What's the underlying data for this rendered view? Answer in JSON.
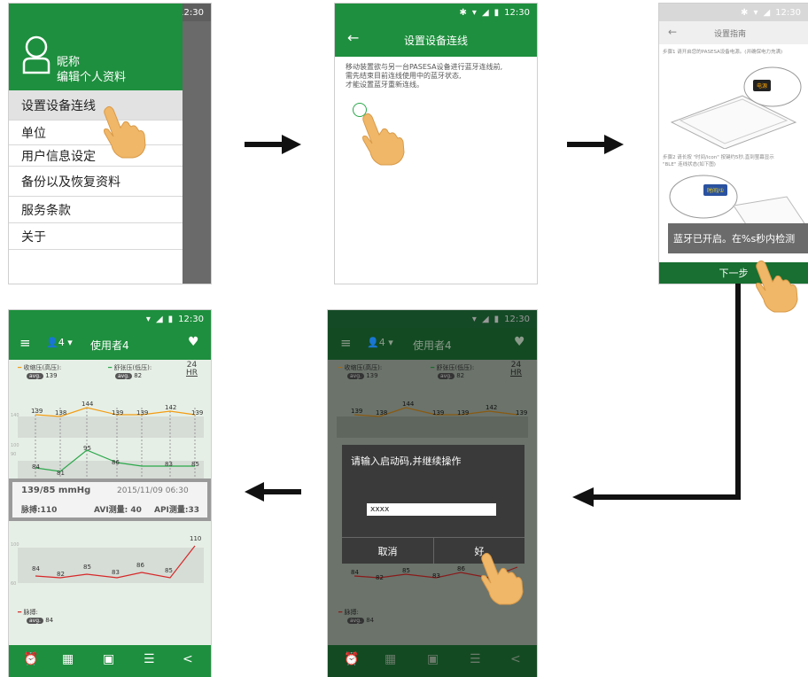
{
  "status_time": "12:30",
  "p1": {
    "nickname": "昵称",
    "edit_profile": "编辑个人资料",
    "menu": [
      "设置设备连线",
      "单位",
      "用户信息设定",
      "备份以及恢复资料",
      "服务条款",
      "关于"
    ]
  },
  "p2": {
    "title": "设置设备连线",
    "body_line1": "移动装置欲与另一台PASESA设备进行蓝牙连线前,",
    "body_line2": "需先结束目前连线使用中的蓝牙状态,",
    "body_line3": "才能设置蓝牙重新连线。"
  },
  "p3": {
    "title": "设置指南",
    "step1": "步骤1 请开启您的PASESA设备电源。(并确保电力充满)",
    "step2_line1": "步骤2 请长按 \"时间/icon\" 按键约5秒,直到萤幕显示",
    "step2_line2": "\"BLE\" 连线状态(如下图)",
    "toast": "蓝牙已开启。在%s秒内检测",
    "next": "下一步",
    "lcd1": "电源",
    "lcd2": "时间/①"
  },
  "p4": {
    "user": "使用者4",
    "user_count": "4",
    "systolic": "收缩压(高压):",
    "diastolic": "舒张压(低压):",
    "avg_sys": "139",
    "avg_dia": "82",
    "range_top": "24",
    "range_bottom": "HR",
    "avg_badge": "avg.",
    "sys_points": [
      "139",
      "138",
      "144",
      "139",
      "139",
      "142",
      "139"
    ],
    "dia_points": [
      "84",
      "81",
      "95",
      "86",
      "83",
      "85"
    ],
    "card_bp": "139/85 mmHg",
    "card_date": "2015/11/09 06:30",
    "card_pulse": "脉搏:110",
    "card_avi": "AVI测量: 40",
    "card_api": "API测量:33",
    "pulse_points": [
      "84",
      "82",
      "85",
      "83",
      "86",
      "85",
      "110"
    ],
    "pulse_label": "脉搏:",
    "avg_pulse": "84",
    "y_140": "140",
    "y_100": "100",
    "y_90": "90",
    "y_60": "60"
  },
  "p5": {
    "dialog_title": "请输入启动码,并继续操作",
    "input_value": "xxxx",
    "cancel": "取消",
    "ok": "好"
  }
}
